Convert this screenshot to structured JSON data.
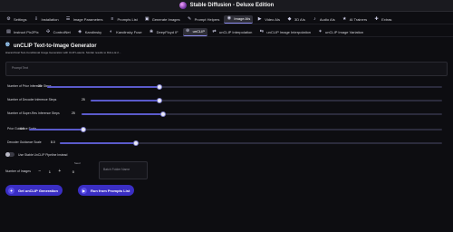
{
  "app": {
    "title": "Stable Diffusion - Deluxe Edition"
  },
  "tabs_primary": [
    {
      "label": "Settings",
      "icon": "gear-icon",
      "glyph": "⚙"
    },
    {
      "label": "Installation",
      "icon": "install-icon",
      "glyph": "⇩"
    },
    {
      "label": "Image Parameters",
      "icon": "sliders-icon",
      "glyph": "☰"
    },
    {
      "label": "Prompts List",
      "icon": "list-icon",
      "glyph": "≡"
    },
    {
      "label": "Generate Images",
      "icon": "image-icon",
      "glyph": "▣"
    },
    {
      "label": "Prompt Helpers",
      "icon": "wand-icon",
      "glyph": "✎"
    },
    {
      "label": "Image AIs",
      "icon": "palette-icon",
      "glyph": "◉"
    },
    {
      "label": "Video AIs",
      "icon": "video-icon",
      "glyph": "▶"
    },
    {
      "label": "3D AIs",
      "icon": "cube-icon",
      "glyph": "◆"
    },
    {
      "label": "Audio AIs",
      "icon": "audio-icon",
      "glyph": "♪"
    },
    {
      "label": "AI Trainers",
      "icon": "trainer-icon",
      "glyph": "★"
    },
    {
      "label": "Extras",
      "icon": "extras-icon",
      "glyph": "✚"
    }
  ],
  "tabs_secondary": [
    {
      "label": "Instruct Pix2Pix",
      "icon": "pix2pix-icon",
      "glyph": "▤"
    },
    {
      "label": "ControlNet",
      "icon": "controlnet-icon",
      "glyph": "✣"
    },
    {
      "label": "Kandinsky",
      "icon": "kandinsky-icon",
      "glyph": "◈"
    },
    {
      "label": "Kandinsky Fuse",
      "icon": "fuse-icon",
      "glyph": "◐"
    },
    {
      "label": "DeepFloyd IF",
      "icon": "deepfloyd-icon",
      "glyph": "❀"
    },
    {
      "label": "unCLIP",
      "icon": "unclip-icon",
      "glyph": "⊕"
    },
    {
      "label": "unCLIP Interpolation",
      "icon": "interpolation-icon",
      "glyph": "⇄"
    },
    {
      "label": "unCLIP Image Interpolation",
      "icon": "image-interpolation-icon",
      "glyph": "⇆"
    },
    {
      "label": "unCLIP Image Variation",
      "icon": "variation-icon",
      "glyph": "✶"
    }
  ],
  "active_primary": "Image AIs",
  "active_secondary": "unCLIP",
  "panel": {
    "title": "unCLIP Text-to-Image Generator",
    "title_icon": "globe-icon",
    "subtitle": "Hierarchical Text-Conditional Image Generation with CLIP Latents.  Similar results to DALL-E 2..."
  },
  "prompt": {
    "label": "Prompt Text",
    "value": ""
  },
  "sliders": [
    {
      "label": "Number of Prior Inference Steps",
      "value": "25",
      "fraction": 0.33
    },
    {
      "label": "Number of Decoder Inference Steps",
      "value": "25",
      "fraction": 0.33
    },
    {
      "label": "Number of Super-Res Inference Steps",
      "value": "25",
      "fraction": 0.33
    },
    {
      "label": "Prior Guidance Scale",
      "value": "4.0",
      "fraction": 0.14
    },
    {
      "label": "Decoder Guidance Scale",
      "value": "8.0",
      "fraction": 0.26
    }
  ],
  "toggle": {
    "label": "Use Stable UnCLIP Pipeline Instead",
    "on": false
  },
  "images": {
    "label": "Number of Images",
    "minus": "−",
    "value": "1",
    "plus": "+"
  },
  "seed": {
    "label": "Seed",
    "value": "0"
  },
  "batch": {
    "placeholder": "Batch Folder Name"
  },
  "buttons": {
    "generate": {
      "label": "Get unCLIP Generation",
      "icon": "generate-icon",
      "glyph": "✦"
    },
    "run_prompts": {
      "label": "Run from Prompts List",
      "icon": "run-list-icon",
      "glyph": "▶"
    }
  },
  "colors": {
    "accent": "#3a2ec4",
    "slider_fill": "#5a5acb",
    "background": "#0d0d11"
  }
}
